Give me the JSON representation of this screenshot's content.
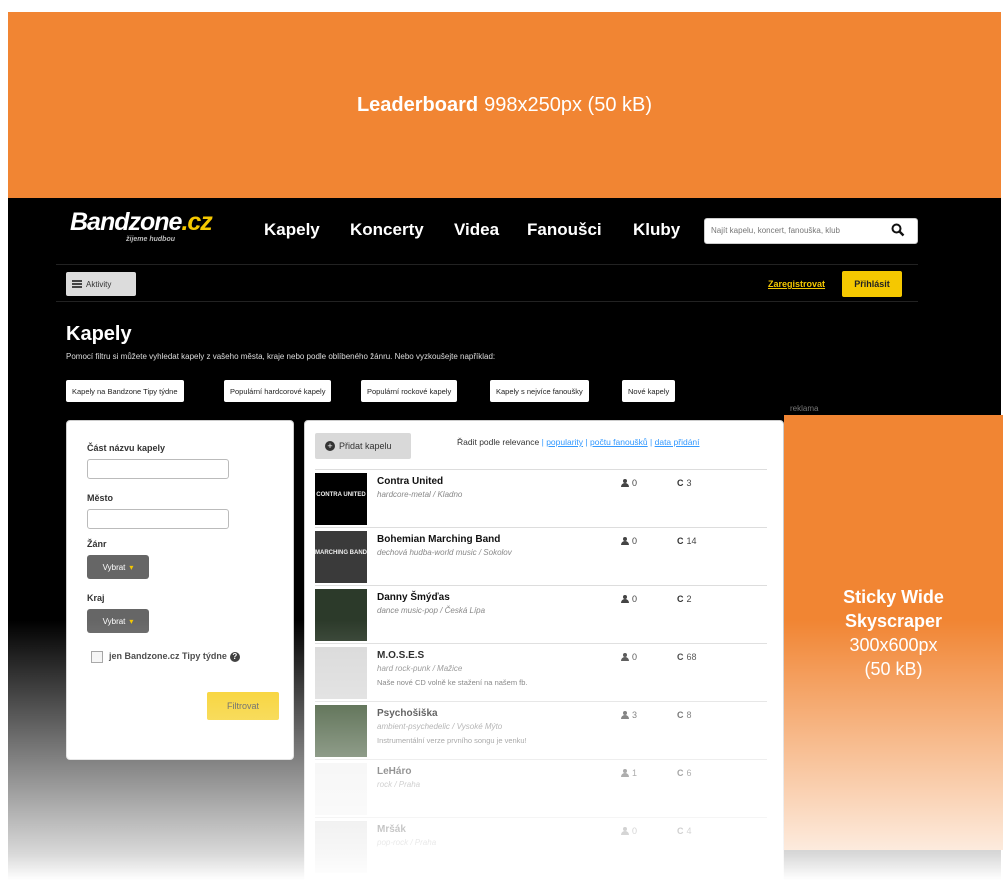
{
  "leaderboard": {
    "title": "Leaderboard",
    "size": "998x250px (50 kB)"
  },
  "header": {
    "logo_main": "Bandzone",
    "logo_tld": ".cz",
    "logo_tagline": "žijeme hudbou",
    "nav": [
      "Kapely",
      "Koncerty",
      "Videa",
      "Fanoušci",
      "Kluby"
    ],
    "search_placeholder": "Najít kapelu, koncert, fanouška, klub",
    "aktivity_label": "Aktivity",
    "register_label": "Zaregistrovat",
    "login_label": "Přihlásit"
  },
  "page": {
    "title": "Kapely",
    "intro": "Pomocí filtru si můžete vyhledat kapely z vašeho města, kraje nebo podle oblíbeného žánru. Nebo vyzkoušejte například:",
    "tags": [
      "Kapely na Bandzone Tipy týdne",
      "Populární hardcorové kapely",
      "Populární rockové kapely",
      "Kapely s nejvíce fanoušky",
      "Nové kapely"
    ],
    "reklama": "reklama"
  },
  "filter": {
    "name_label": "Část názvu kapely",
    "city_label": "Město",
    "genre_label": "Žánr",
    "genre_select": "Vybrat",
    "region_label": "Kraj",
    "region_select": "Vybrat",
    "checkbox_label": "jen Bandzone.cz Tipy týdne",
    "submit_label": "Filtrovat"
  },
  "results": {
    "add_label": "Přidat kapelu",
    "sort_prefix": "Řadit podle relevance",
    "sort_links": [
      "popularity",
      "počtu fanoušků",
      "data přidání"
    ],
    "bands": [
      {
        "name": "Contra United",
        "genre": "hardcore-metal / Kladno",
        "note": "",
        "fans": "0",
        "plays": "3",
        "thumb": "#000000",
        "thumb_text": "CONTRA UNITED"
      },
      {
        "name": "Bohemian Marching Band",
        "genre": "dechová hudba-world music / Sokolov",
        "note": "",
        "fans": "0",
        "plays": "14",
        "thumb": "#3a3a3a",
        "thumb_text": "MARCHING BAND"
      },
      {
        "name": "Danny Šmýďas",
        "genre": "dance music-pop / Česká Lípa",
        "note": "",
        "fans": "0",
        "plays": "2",
        "thumb": "#2c3a2a",
        "thumb_text": ""
      },
      {
        "name": "M.O.S.E.S",
        "genre": "hard rock-punk / Mažice",
        "note": "Naše nové CD volně ke stažení na našem fb.",
        "fans": "0",
        "plays": "68",
        "thumb": "#d8d8d8",
        "thumb_text": ""
      },
      {
        "name": "Psychošiška",
        "genre": "ambient-psychedelic / Vysoké Mýto",
        "note": "Instrumentální verze prvního songu je venku!",
        "fans": "3",
        "plays": "8",
        "thumb": "#1f3a14",
        "thumb_text": ""
      },
      {
        "name": "LeHáro",
        "genre": "rock / Praha",
        "note": "",
        "fans": "1",
        "plays": "6",
        "thumb": "#eeeeee",
        "thumb_text": ""
      },
      {
        "name": "Mršák",
        "genre": "pop-rock / Praha",
        "note": "",
        "fans": "0",
        "plays": "4",
        "thumb": "#cccccc",
        "thumb_text": ""
      }
    ]
  },
  "skyscraper": {
    "title_line1": "Sticky Wide",
    "title_line2": "Skyscraper",
    "size": "300x600px",
    "weight": "(50 kB)"
  },
  "colors": {
    "ad_orange": "#f18533",
    "accent_yellow": "#f5c800",
    "link_blue": "#3399ff",
    "site_bg": "#000000"
  }
}
